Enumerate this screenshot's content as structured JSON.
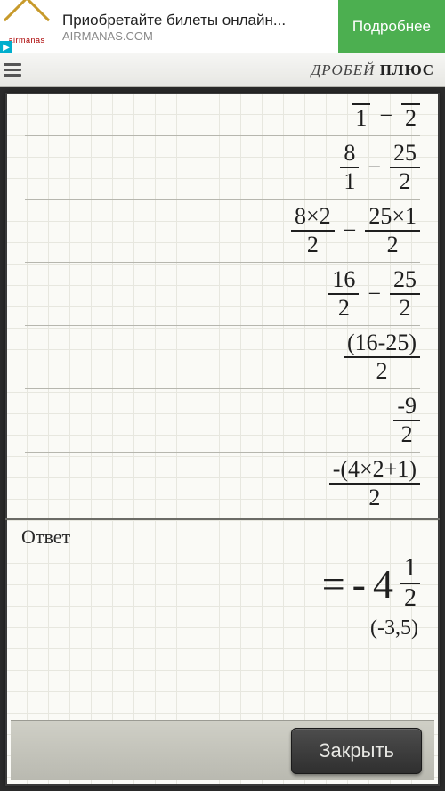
{
  "ad": {
    "brand": "airmanas",
    "title": "Приобретайте билеты онлайн...",
    "url": "AIRMANAS.COM",
    "cta": "Подробнее"
  },
  "header": {
    "title_light": "ДРОБЕЙ ",
    "title_bold": "ПЛЮС"
  },
  "steps": [
    {
      "l_num": " ",
      "l_den": "1",
      "op": "−",
      "r_num": " ",
      "r_den": "2"
    },
    {
      "l_num": "8",
      "l_den": "1",
      "op": "−",
      "r_num": "25",
      "r_den": "2"
    },
    {
      "l_num": "8×2",
      "l_den": "2",
      "op": "−",
      "r_num": "25×1",
      "r_den": "2"
    },
    {
      "l_num": "16",
      "l_den": "2",
      "op": "−",
      "r_num": "25",
      "r_den": "2"
    },
    {
      "single_num": "(16-25)",
      "single_den": "2"
    },
    {
      "single_num": "-9",
      "single_den": "2"
    },
    {
      "single_num": "-(4×2+1)",
      "single_den": "2"
    }
  ],
  "answer": {
    "label": "Ответ",
    "eq": "=",
    "sign": "-",
    "whole": "4",
    "frac_num": "1",
    "frac_den": "2",
    "decimal": "(-3,5)"
  },
  "buttons": {
    "close": "Закрыть"
  }
}
